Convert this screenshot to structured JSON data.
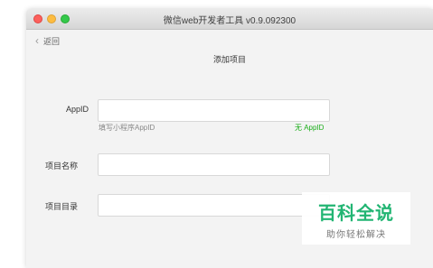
{
  "window": {
    "title": "微信web开发者工具 v0.9.092300"
  },
  "nav": {
    "back_label": "返回"
  },
  "page": {
    "title": "添加项目"
  },
  "form": {
    "appid": {
      "label": "AppID",
      "value": "",
      "hint": "填写小程序AppID",
      "no_appid_link": "无 AppID"
    },
    "project_name": {
      "label": "项目名称",
      "value": ""
    },
    "project_dir": {
      "label": "项目目录",
      "value": ""
    }
  },
  "watermark": {
    "title": "百科全说",
    "subtitle": "助你轻松解决"
  },
  "colors": {
    "link_green": "#1aad19",
    "watermark_green": "#22b573"
  },
  "icons": {
    "back": "chevron-left-icon"
  }
}
